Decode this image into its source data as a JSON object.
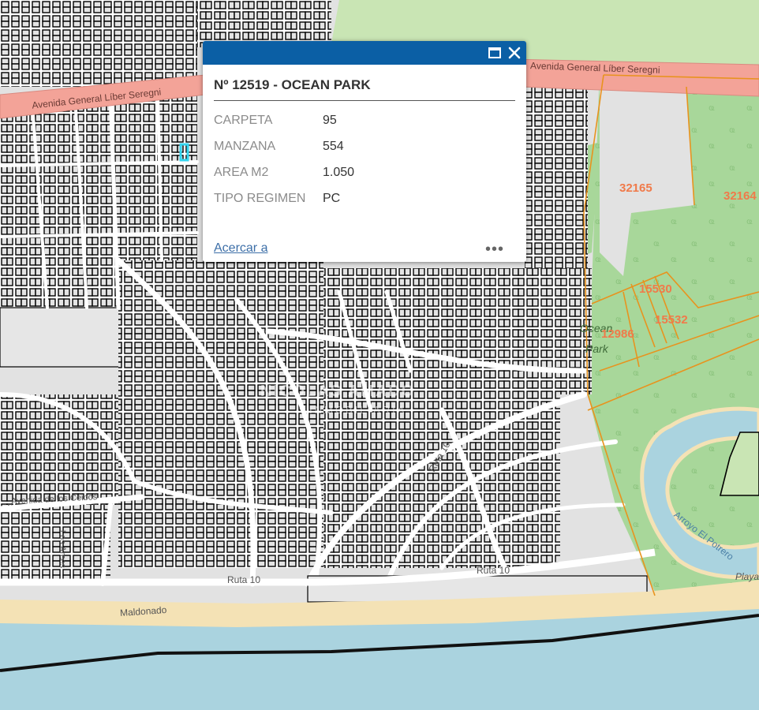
{
  "popup": {
    "title": "Nº 12519 - OCEAN PARK",
    "attributes": [
      {
        "label": "CARPETA",
        "value": "95"
      },
      {
        "label": "MANZANA",
        "value": "554"
      },
      {
        "label": "AREA M2",
        "value": "1.050"
      },
      {
        "label": "TIPO REGIMEN",
        "value": "PC"
      }
    ],
    "zoom_link": "Acercar a",
    "more_label": "•••",
    "header_color": "#0b5fa5"
  },
  "map": {
    "street_labels": {
      "avenue_right": "Avenida General Líber Seregni",
      "avenue_left": "Avenida General Líber Seregni",
      "ruta10_mid": "Ruta 10",
      "ruta10_low": "Ruta 10",
      "ruta10_bottom": "Ruta 10",
      "ceibos": "Avenida de los Ceibos",
      "arces": "Los Arces",
      "maldonado": "Maldonado",
      "arroyo": "Arroyo El Potrero",
      "playa": "Playa",
      "ocean": "Ocean",
      "park": "Park"
    },
    "parcels": [
      "32165",
      "32164",
      "15530",
      "15532",
      "12986"
    ],
    "watermark": "NICOLAS AMADO",
    "watermark_sub": "INMOBILIARIA",
    "colors": {
      "land": "#e2e2e2",
      "park": "#a8d79a",
      "sea": "#aad3df",
      "beach": "#f4e2b5",
      "main_road": "#f3a398",
      "parcel_outline": "#e8931e",
      "parcel_label": "#f07a4a"
    }
  }
}
